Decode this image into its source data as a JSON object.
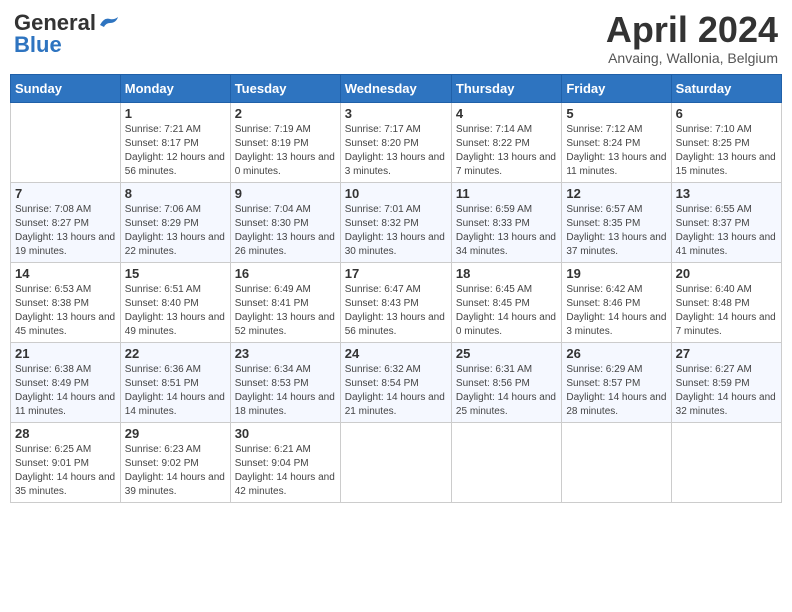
{
  "logo": {
    "line1": "General",
    "line2": "Blue"
  },
  "title": "April 2024",
  "subtitle": "Anvaing, Wallonia, Belgium",
  "days_of_week": [
    "Sunday",
    "Monday",
    "Tuesday",
    "Wednesday",
    "Thursday",
    "Friday",
    "Saturday"
  ],
  "weeks": [
    [
      {
        "day": "",
        "sunrise": "",
        "sunset": "",
        "daylight": ""
      },
      {
        "day": "1",
        "sunrise": "Sunrise: 7:21 AM",
        "sunset": "Sunset: 8:17 PM",
        "daylight": "Daylight: 12 hours and 56 minutes."
      },
      {
        "day": "2",
        "sunrise": "Sunrise: 7:19 AM",
        "sunset": "Sunset: 8:19 PM",
        "daylight": "Daylight: 13 hours and 0 minutes."
      },
      {
        "day": "3",
        "sunrise": "Sunrise: 7:17 AM",
        "sunset": "Sunset: 8:20 PM",
        "daylight": "Daylight: 13 hours and 3 minutes."
      },
      {
        "day": "4",
        "sunrise": "Sunrise: 7:14 AM",
        "sunset": "Sunset: 8:22 PM",
        "daylight": "Daylight: 13 hours and 7 minutes."
      },
      {
        "day": "5",
        "sunrise": "Sunrise: 7:12 AM",
        "sunset": "Sunset: 8:24 PM",
        "daylight": "Daylight: 13 hours and 11 minutes."
      },
      {
        "day": "6",
        "sunrise": "Sunrise: 7:10 AM",
        "sunset": "Sunset: 8:25 PM",
        "daylight": "Daylight: 13 hours and 15 minutes."
      }
    ],
    [
      {
        "day": "7",
        "sunrise": "Sunrise: 7:08 AM",
        "sunset": "Sunset: 8:27 PM",
        "daylight": "Daylight: 13 hours and 19 minutes."
      },
      {
        "day": "8",
        "sunrise": "Sunrise: 7:06 AM",
        "sunset": "Sunset: 8:29 PM",
        "daylight": "Daylight: 13 hours and 22 minutes."
      },
      {
        "day": "9",
        "sunrise": "Sunrise: 7:04 AM",
        "sunset": "Sunset: 8:30 PM",
        "daylight": "Daylight: 13 hours and 26 minutes."
      },
      {
        "day": "10",
        "sunrise": "Sunrise: 7:01 AM",
        "sunset": "Sunset: 8:32 PM",
        "daylight": "Daylight: 13 hours and 30 minutes."
      },
      {
        "day": "11",
        "sunrise": "Sunrise: 6:59 AM",
        "sunset": "Sunset: 8:33 PM",
        "daylight": "Daylight: 13 hours and 34 minutes."
      },
      {
        "day": "12",
        "sunrise": "Sunrise: 6:57 AM",
        "sunset": "Sunset: 8:35 PM",
        "daylight": "Daylight: 13 hours and 37 minutes."
      },
      {
        "day": "13",
        "sunrise": "Sunrise: 6:55 AM",
        "sunset": "Sunset: 8:37 PM",
        "daylight": "Daylight: 13 hours and 41 minutes."
      }
    ],
    [
      {
        "day": "14",
        "sunrise": "Sunrise: 6:53 AM",
        "sunset": "Sunset: 8:38 PM",
        "daylight": "Daylight: 13 hours and 45 minutes."
      },
      {
        "day": "15",
        "sunrise": "Sunrise: 6:51 AM",
        "sunset": "Sunset: 8:40 PM",
        "daylight": "Daylight: 13 hours and 49 minutes."
      },
      {
        "day": "16",
        "sunrise": "Sunrise: 6:49 AM",
        "sunset": "Sunset: 8:41 PM",
        "daylight": "Daylight: 13 hours and 52 minutes."
      },
      {
        "day": "17",
        "sunrise": "Sunrise: 6:47 AM",
        "sunset": "Sunset: 8:43 PM",
        "daylight": "Daylight: 13 hours and 56 minutes."
      },
      {
        "day": "18",
        "sunrise": "Sunrise: 6:45 AM",
        "sunset": "Sunset: 8:45 PM",
        "daylight": "Daylight: 14 hours and 0 minutes."
      },
      {
        "day": "19",
        "sunrise": "Sunrise: 6:42 AM",
        "sunset": "Sunset: 8:46 PM",
        "daylight": "Daylight: 14 hours and 3 minutes."
      },
      {
        "day": "20",
        "sunrise": "Sunrise: 6:40 AM",
        "sunset": "Sunset: 8:48 PM",
        "daylight": "Daylight: 14 hours and 7 minutes."
      }
    ],
    [
      {
        "day": "21",
        "sunrise": "Sunrise: 6:38 AM",
        "sunset": "Sunset: 8:49 PM",
        "daylight": "Daylight: 14 hours and 11 minutes."
      },
      {
        "day": "22",
        "sunrise": "Sunrise: 6:36 AM",
        "sunset": "Sunset: 8:51 PM",
        "daylight": "Daylight: 14 hours and 14 minutes."
      },
      {
        "day": "23",
        "sunrise": "Sunrise: 6:34 AM",
        "sunset": "Sunset: 8:53 PM",
        "daylight": "Daylight: 14 hours and 18 minutes."
      },
      {
        "day": "24",
        "sunrise": "Sunrise: 6:32 AM",
        "sunset": "Sunset: 8:54 PM",
        "daylight": "Daylight: 14 hours and 21 minutes."
      },
      {
        "day": "25",
        "sunrise": "Sunrise: 6:31 AM",
        "sunset": "Sunset: 8:56 PM",
        "daylight": "Daylight: 14 hours and 25 minutes."
      },
      {
        "day": "26",
        "sunrise": "Sunrise: 6:29 AM",
        "sunset": "Sunset: 8:57 PM",
        "daylight": "Daylight: 14 hours and 28 minutes."
      },
      {
        "day": "27",
        "sunrise": "Sunrise: 6:27 AM",
        "sunset": "Sunset: 8:59 PM",
        "daylight": "Daylight: 14 hours and 32 minutes."
      }
    ],
    [
      {
        "day": "28",
        "sunrise": "Sunrise: 6:25 AM",
        "sunset": "Sunset: 9:01 PM",
        "daylight": "Daylight: 14 hours and 35 minutes."
      },
      {
        "day": "29",
        "sunrise": "Sunrise: 6:23 AM",
        "sunset": "Sunset: 9:02 PM",
        "daylight": "Daylight: 14 hours and 39 minutes."
      },
      {
        "day": "30",
        "sunrise": "Sunrise: 6:21 AM",
        "sunset": "Sunset: 9:04 PM",
        "daylight": "Daylight: 14 hours and 42 minutes."
      },
      {
        "day": "",
        "sunrise": "",
        "sunset": "",
        "daylight": ""
      },
      {
        "day": "",
        "sunrise": "",
        "sunset": "",
        "daylight": ""
      },
      {
        "day": "",
        "sunrise": "",
        "sunset": "",
        "daylight": ""
      },
      {
        "day": "",
        "sunrise": "",
        "sunset": "",
        "daylight": ""
      }
    ]
  ]
}
